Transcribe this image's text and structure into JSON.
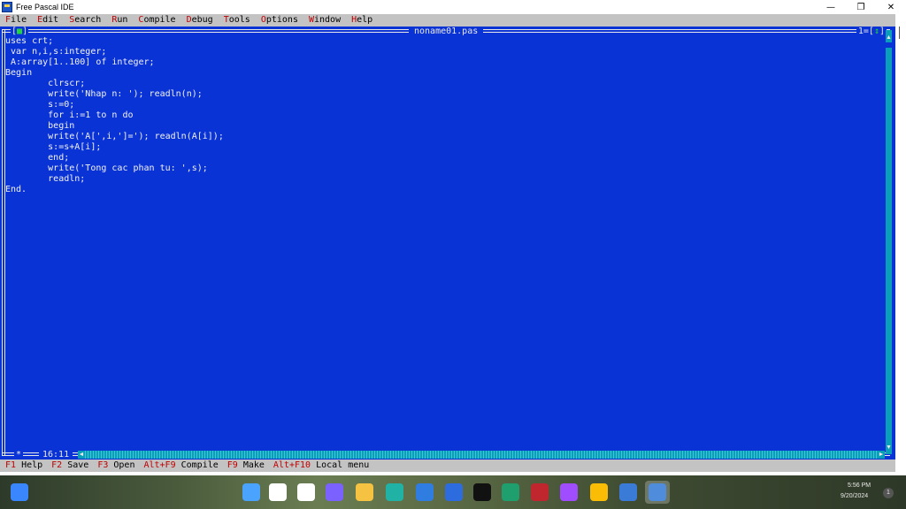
{
  "window": {
    "title": "Free Pascal IDE",
    "minimize": "—",
    "maximize": "❐",
    "close": "✕"
  },
  "menu": [
    {
      "hot": "F",
      "rest": "ile"
    },
    {
      "hot": "E",
      "rest": "dit"
    },
    {
      "hot": "S",
      "rest": "earch"
    },
    {
      "hot": "R",
      "rest": "un"
    },
    {
      "hot": "C",
      "rest": "ompile"
    },
    {
      "hot": "D",
      "rest": "ebug"
    },
    {
      "hot": "T",
      "rest": "ools"
    },
    {
      "hot": "O",
      "rest": "ptions"
    },
    {
      "hot": "W",
      "rest": "indow"
    },
    {
      "hot": "H",
      "rest": "elp"
    }
  ],
  "editor": {
    "close_left": "[",
    "close_mark": "■",
    "close_right": "]",
    "filename": "noname01.pas",
    "win_number": "1=[",
    "win_mark": "↕",
    "win_number_end": "]",
    "modified_mark": "*",
    "cursor_pos": "16:11",
    "code_lines": [
      "uses crt;",
      " var n,i,s:integer;",
      " A:array[1..100] of integer;",
      "Begin",
      "        clrscr;",
      "        write('Nhap n: '); readln(n);",
      "        s:=0;",
      "        for i:=1 to n do",
      "        begin",
      "        write('A[',i,']='); readln(A[i]);",
      "        s:=s+A[i];",
      "        end;",
      "        write('Tong cac phan tu: ',s);",
      "        readln;",
      "End."
    ]
  },
  "status": [
    {
      "key": "F1",
      "label": " Help"
    },
    {
      "key": "F2",
      "label": " Save"
    },
    {
      "key": "F3",
      "label": " Open"
    },
    {
      "key": "Alt+F9",
      "label": " Compile"
    },
    {
      "key": "F9",
      "label": " Make"
    },
    {
      "key": "Alt+F10",
      "label": " Local menu"
    }
  ],
  "taskbar": {
    "icons": [
      {
        "name": "widgets-icon",
        "color": "#3a86ff"
      },
      {
        "name": "start-icon",
        "color": "#4aa3ff"
      },
      {
        "name": "search-icon",
        "color": "#ffffff"
      },
      {
        "name": "task-view-icon",
        "color": "#ffffff"
      },
      {
        "name": "teams-icon",
        "color": "#7b61ff"
      },
      {
        "name": "file-explorer-icon",
        "color": "#f5c242"
      },
      {
        "name": "edge-icon",
        "color": "#20b3a5"
      },
      {
        "name": "store-icon",
        "color": "#2f7de1"
      },
      {
        "name": "ccleaner-icon",
        "color": "#2d6cdf"
      },
      {
        "name": "tiktok-icon",
        "color": "#111111"
      },
      {
        "name": "download-manager-icon",
        "color": "#1f9e6e"
      },
      {
        "name": "antivirus-icon",
        "color": "#c0262d"
      },
      {
        "name": "messenger-icon",
        "color": "#a04cff"
      },
      {
        "name": "chrome-icon",
        "color": "#fbbc05"
      },
      {
        "name": "translator-icon",
        "color": "#3b7bd8"
      },
      {
        "name": "free-pascal-icon",
        "color": "#4f8ddc"
      }
    ],
    "tray_time": "5:56 PM",
    "tray_date": "9/20/2024",
    "notification_count": "1"
  }
}
